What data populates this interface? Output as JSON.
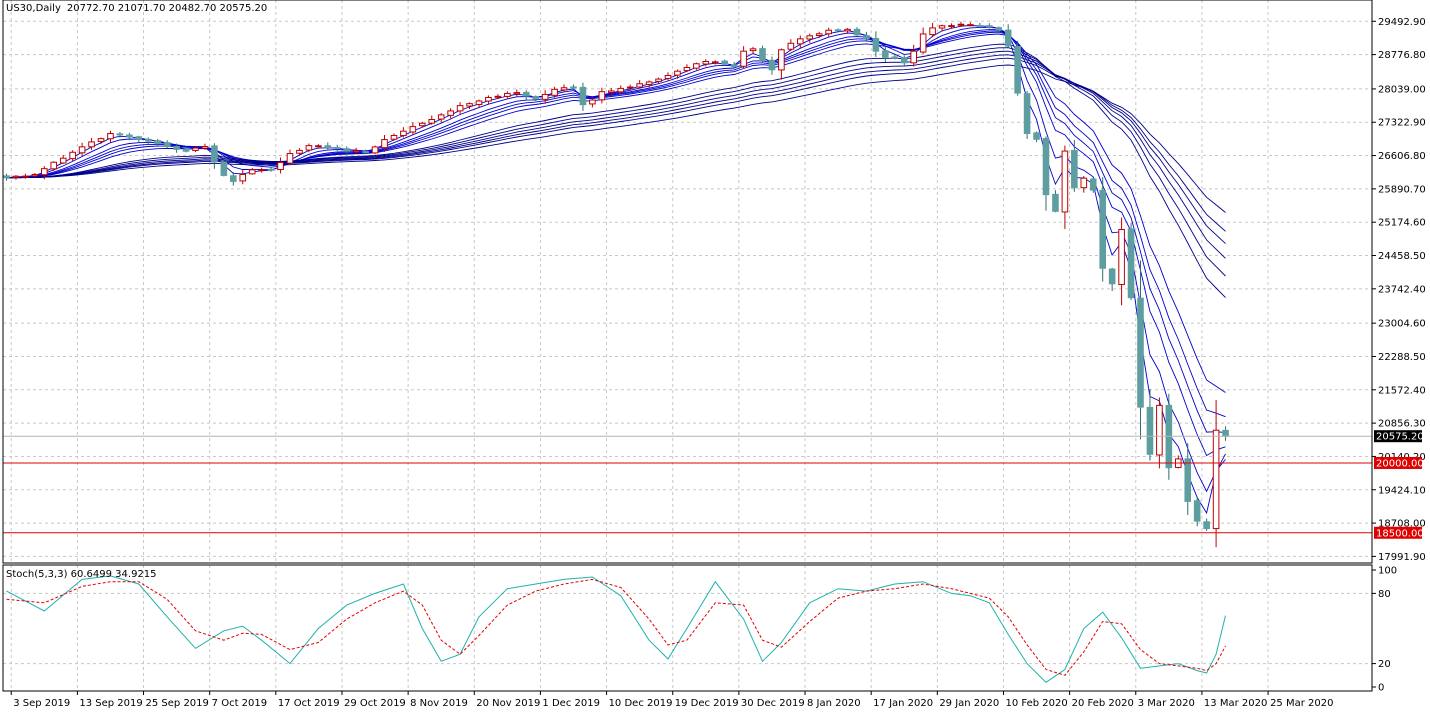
{
  "header": {
    "symbol": "US30,Daily",
    "ohlc": "20772.70 21071.70 20482.70 20575.20"
  },
  "indicator": {
    "label": "Stoch(5,3,3) 60.6499 34.9215"
  },
  "colors": {
    "bull": "#c00000",
    "bear": "#5f9ea0",
    "ema": "#00008b",
    "grid": "#c8c8c8",
    "hline": "#e00000",
    "bid": "#b4b4b4",
    "stoch_main": "#20b2aa",
    "stoch_signal": "#e00000"
  },
  "chart_data": [
    {
      "type": "candlestick",
      "y_ticks": [
        "29492.90",
        "28776.80",
        "28039.00",
        "27322.90",
        "26606.80",
        "25890.70",
        "25174.60",
        "24458.50",
        "23742.40",
        "23004.60",
        "22288.50",
        "21572.40",
        "20856.30",
        "20140.20",
        "19424.10",
        "18708.00",
        "17991.90"
      ],
      "ylim": [
        17850,
        29950
      ],
      "x_labels": [
        "3 Sep 2019",
        "13 Sep 2019",
        "25 Sep 2019",
        "7 Oct 2019",
        "17 Oct 2019",
        "29 Oct 2019",
        "8 Nov 2019",
        "20 Nov 2019",
        "1 Dec 2019",
        "10 Dec 2019",
        "19 Dec 2019",
        "30 Dec 2019",
        "8 Jan 2020",
        "17 Jan 2020",
        "29 Jan 2020",
        "10 Feb 2020",
        "20 Feb 2020",
        "3 Mar 2020",
        "13 Mar 2020",
        "25 Mar 2020"
      ],
      "price_line": {
        "label": "20575.20",
        "value": 20575.2
      },
      "hlines": [
        {
          "label": "20000.00",
          "value": 20000
        },
        {
          "label": "18500.00",
          "value": 18500
        }
      ],
      "close_path": [
        [
          0,
          26130
        ],
        [
          3,
          26200
        ],
        [
          6,
          26550
        ],
        [
          9,
          26900
        ],
        [
          11,
          27080
        ],
        [
          14,
          26950
        ],
        [
          17,
          26800
        ],
        [
          19,
          26700
        ],
        [
          21,
          26800
        ],
        [
          23,
          26180
        ],
        [
          24,
          26050
        ],
        [
          25,
          26200
        ],
        [
          26,
          26300
        ],
        [
          28,
          26300
        ],
        [
          30,
          26650
        ],
        [
          32,
          26820
        ],
        [
          34,
          26780
        ],
        [
          36,
          26700
        ],
        [
          38,
          26680
        ],
        [
          40,
          26950
        ],
        [
          42,
          27130
        ],
        [
          44,
          27300
        ],
        [
          46,
          27480
        ],
        [
          48,
          27680
        ],
        [
          50,
          27780
        ],
        [
          52,
          27880
        ],
        [
          54,
          27960
        ],
        [
          56,
          27820
        ],
        [
          58,
          28030
        ],
        [
          60,
          28060
        ],
        [
          61,
          27700
        ],
        [
          62,
          27800
        ],
        [
          63,
          27980
        ],
        [
          65,
          28050
        ],
        [
          67,
          28150
        ],
        [
          69,
          28250
        ],
        [
          71,
          28420
        ],
        [
          73,
          28580
        ],
        [
          75,
          28620
        ],
        [
          77,
          28520
        ],
        [
          78,
          28850
        ],
        [
          79,
          28900
        ],
        [
          80,
          28650
        ],
        [
          81,
          28450
        ],
        [
          82,
          28880
        ],
        [
          83,
          29020
        ],
        [
          85,
          29180
        ],
        [
          87,
          29300
        ],
        [
          89,
          29320
        ],
        [
          90,
          29200
        ],
        [
          91,
          29120
        ],
        [
          92,
          28850
        ],
        [
          93,
          28720
        ],
        [
          94,
          28700
        ],
        [
          95,
          28600
        ],
        [
          96,
          28850
        ],
        [
          97,
          29220
        ],
        [
          98,
          29350
        ],
        [
          100,
          29400
        ],
        [
          102,
          29420
        ],
        [
          104,
          29370
        ],
        [
          105,
          29300
        ],
        [
          106,
          28960
        ],
        [
          107,
          27950
        ],
        [
          108,
          27081
        ],
        [
          109,
          26957
        ],
        [
          110,
          25766
        ],
        [
          111,
          25409
        ],
        [
          112,
          26703
        ],
        [
          113,
          25917
        ],
        [
          114,
          26121
        ],
        [
          115,
          25864
        ],
        [
          116,
          24185
        ],
        [
          117,
          23851
        ],
        [
          118,
          25018
        ],
        [
          119,
          23553
        ],
        [
          120,
          21200
        ],
        [
          121,
          20188
        ],
        [
          122,
          21237
        ],
        [
          123,
          19898
        ],
        [
          124,
          20087
        ],
        [
          125,
          19174
        ],
        [
          126,
          18750
        ],
        [
          127,
          18591
        ],
        [
          128,
          20704
        ],
        [
          129,
          20575
        ]
      ]
    },
    {
      "type": "line",
      "ylim": [
        0,
        100
      ],
      "y_ticks": [
        100,
        80,
        20,
        0
      ],
      "series": [
        {
          "values": [
            [
              0,
              82
            ],
            [
              4,
              65
            ],
            [
              8,
              92
            ],
            [
              11,
              95
            ],
            [
              14,
              88
            ],
            [
              17,
              60
            ],
            [
              20,
              33
            ],
            [
              23,
              48
            ],
            [
              25,
              52
            ],
            [
              27,
              40
            ],
            [
              30,
              20
            ],
            [
              33,
              50
            ],
            [
              36,
              70
            ],
            [
              39,
              80
            ],
            [
              42,
              88
            ],
            [
              44,
              50
            ],
            [
              46,
              22
            ],
            [
              48,
              28
            ],
            [
              50,
              60
            ],
            [
              53,
              84
            ],
            [
              56,
              88
            ],
            [
              59,
              92
            ],
            [
              62,
              94
            ],
            [
              65,
              78
            ],
            [
              68,
              40
            ],
            [
              70,
              24
            ],
            [
              72,
              50
            ],
            [
              75,
              90
            ],
            [
              78,
              58
            ],
            [
              80,
              22
            ],
            [
              82,
              38
            ],
            [
              85,
              72
            ],
            [
              88,
              84
            ],
            [
              91,
              82
            ],
            [
              94,
              88
            ],
            [
              97,
              90
            ],
            [
              100,
              80
            ],
            [
              102,
              78
            ],
            [
              104,
              72
            ],
            [
              106,
              45
            ],
            [
              108,
              20
            ],
            [
              110,
              4
            ],
            [
              112,
              15
            ],
            [
              114,
              50
            ],
            [
              116,
              64
            ],
            [
              118,
              42
            ],
            [
              120,
              16
            ],
            [
              122,
              18
            ],
            [
              124,
              20
            ],
            [
              126,
              14
            ],
            [
              127,
              12
            ],
            [
              128,
              28
            ],
            [
              129,
              61
            ]
          ]
        },
        {
          "values": [
            [
              0,
              75
            ],
            [
              4,
              72
            ],
            [
              8,
              86
            ],
            [
              11,
              90
            ],
            [
              14,
              90
            ],
            [
              17,
              75
            ],
            [
              20,
              48
            ],
            [
              23,
              40
            ],
            [
              25,
              46
            ],
            [
              27,
              45
            ],
            [
              30,
              32
            ],
            [
              33,
              38
            ],
            [
              36,
              58
            ],
            [
              39,
              72
            ],
            [
              42,
              82
            ],
            [
              44,
              70
            ],
            [
              46,
              40
            ],
            [
              48,
              28
            ],
            [
              50,
              44
            ],
            [
              53,
              70
            ],
            [
              56,
              82
            ],
            [
              59,
              88
            ],
            [
              62,
              92
            ],
            [
              65,
              85
            ],
            [
              68,
              58
            ],
            [
              70,
              36
            ],
            [
              72,
              40
            ],
            [
              75,
              72
            ],
            [
              78,
              70
            ],
            [
              80,
              40
            ],
            [
              82,
              34
            ],
            [
              85,
              56
            ],
            [
              88,
              76
            ],
            [
              91,
              82
            ],
            [
              94,
              84
            ],
            [
              97,
              88
            ],
            [
              100,
              84
            ],
            [
              102,
              80
            ],
            [
              104,
              76
            ],
            [
              106,
              60
            ],
            [
              108,
              36
            ],
            [
              110,
              15
            ],
            [
              112,
              10
            ],
            [
              114,
              30
            ],
            [
              116,
              56
            ],
            [
              118,
              54
            ],
            [
              120,
              32
            ],
            [
              122,
              20
            ],
            [
              124,
              18
            ],
            [
              126,
              16
            ],
            [
              127,
              14
            ],
            [
              128,
              20
            ],
            [
              129,
              35
            ]
          ]
        }
      ]
    }
  ]
}
